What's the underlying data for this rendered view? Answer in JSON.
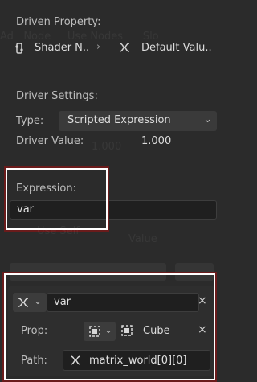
{
  "driven_property": {
    "header": "Driven Property:",
    "left_item": "Shader N..",
    "right_item": "Default Valu.."
  },
  "driver_settings": {
    "header": "Driver Settings:",
    "type_label": "Type:",
    "type_value": "Scripted Expression",
    "value_label": "Driver Value:",
    "value": "1.000"
  },
  "expression": {
    "label": "Expression:",
    "value": "var"
  },
  "variable": {
    "name": "var",
    "prop_label": "Prop:",
    "prop_value": "Cube",
    "path_label": "Path:",
    "path_value": "matrix_world[0][0]"
  },
  "colors": {
    "background": "#2b2b2b",
    "field": "#1f1f1f",
    "highlight_border": "#ffffff",
    "highlight_outline": "#6a1b1b"
  }
}
